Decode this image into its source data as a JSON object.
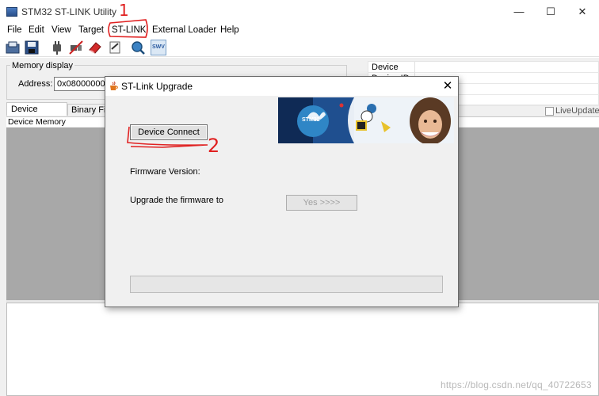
{
  "window": {
    "title": "STM32 ST-LINK Utility",
    "controls": {
      "minimize": "—",
      "maximize": "☐",
      "close": "✕"
    }
  },
  "menubar": {
    "items": [
      "File",
      "Edit",
      "View",
      "Target",
      "ST-LINK",
      "External Loader",
      "Help"
    ]
  },
  "toolbar": {
    "icons": [
      "save-file-icon",
      "save-icon",
      "connect-icon",
      "disconnect-icon",
      "erase-icon",
      "program-icon",
      "verify-icon",
      "swv-icon"
    ],
    "swv_label": "SWV"
  },
  "memory_display": {
    "label": "Memory display",
    "address_label": "Address:",
    "address_value": "0x08000000"
  },
  "device_info": {
    "rows": [
      "Device",
      "Device ID"
    ]
  },
  "tabs": [
    "Device Memory",
    "Binary File"
  ],
  "live_update": {
    "label": "LiveUpdate",
    "checked": false
  },
  "memory_header": "Device Memory",
  "watermark": "https://blog.csdn.net/qq_40722653",
  "dialog": {
    "title": "ST-Link Upgrade",
    "close": "✕",
    "device_connect": "Device Connect",
    "firmware_version_label": "Firmware Version:",
    "upgrade_label": "Upgrade the firmware to",
    "yes_button": "Yes >>>>",
    "banner_chip_text": "STM32",
    "progress": 0
  },
  "annotations": {
    "step1": "1",
    "step2": "2",
    "color": "#e02020"
  }
}
